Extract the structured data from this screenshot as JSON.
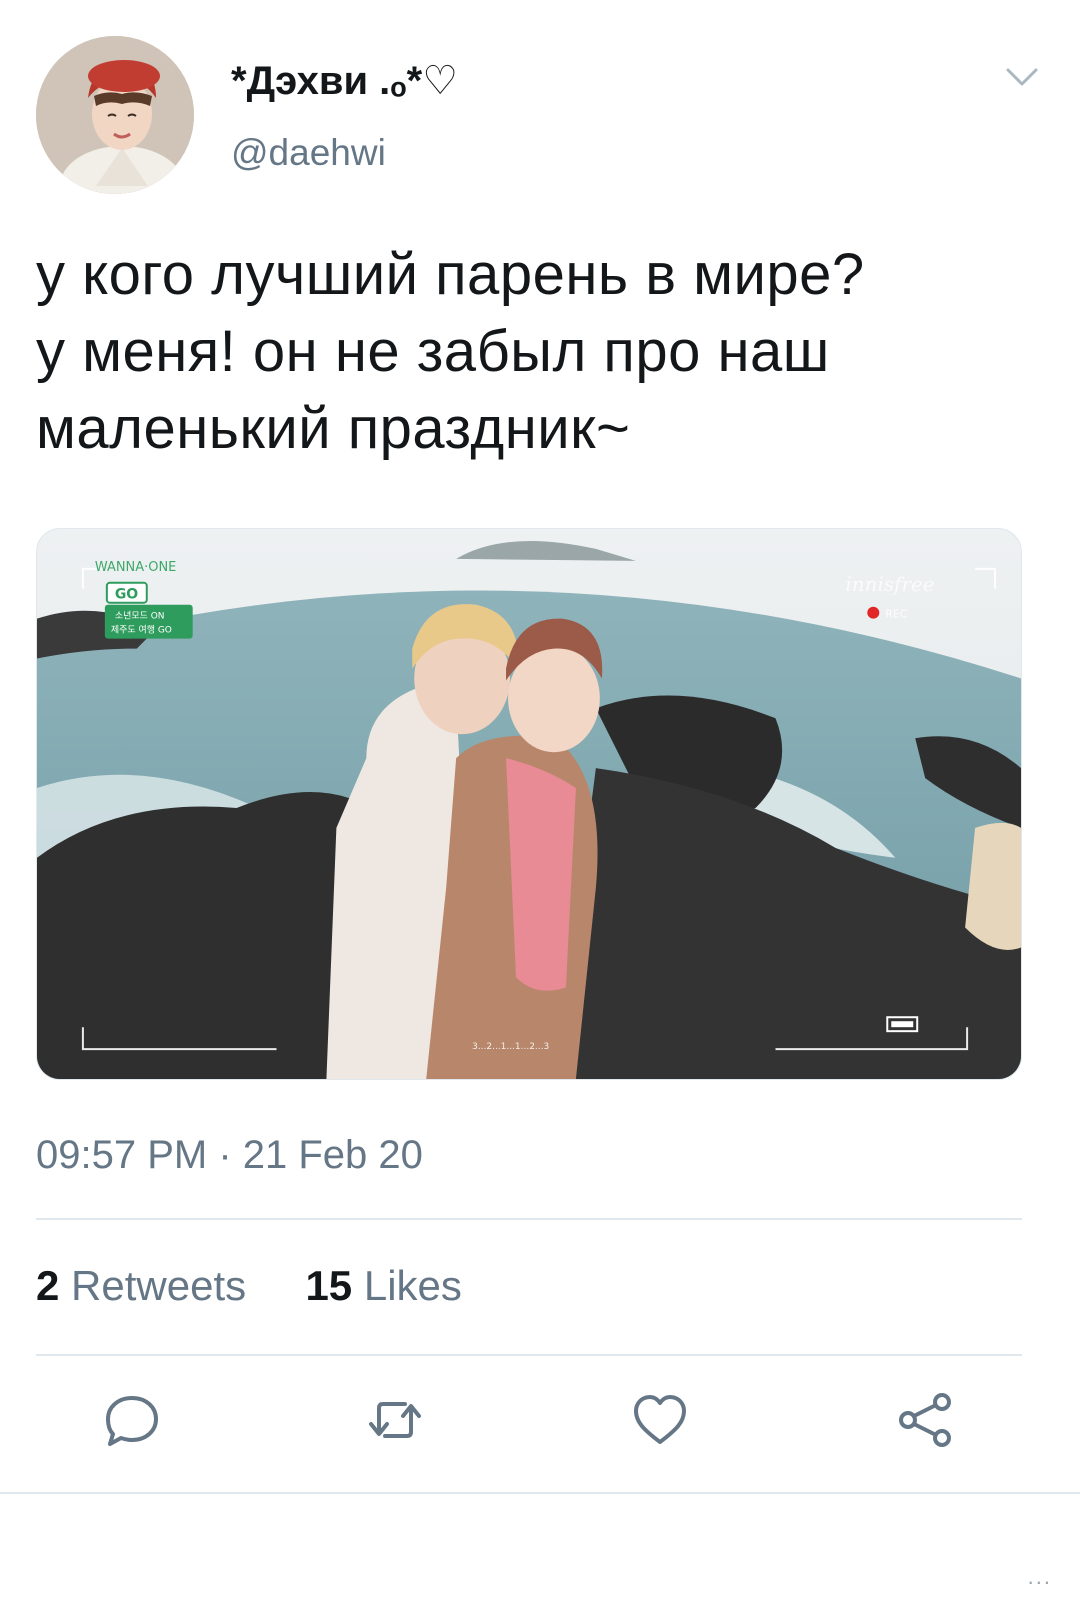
{
  "user": {
    "display_name": "*Дэхви .ₒ*♡",
    "handle": "@daehwi"
  },
  "tweet": {
    "lines": [
      "у кого лучший парень в мире?",
      "у меня! он не забыл про наш",
      "маленький праздник~"
    ],
    "timestamp": "09:57 PM · 21 Feb 20"
  },
  "media": {
    "overlay": {
      "show_logo": "WANNA·ONE",
      "show_go": "GO",
      "show_sub1": "소년모드 ON",
      "show_sub2": "제주도 여행 GO",
      "brand": "innisfree",
      "rec": "REC",
      "counter": "3...2...1...1...2...3"
    }
  },
  "stats": {
    "retweets_count": "2",
    "retweets_label": "Retweets",
    "likes_count": "15",
    "likes_label": "Likes"
  },
  "actions": {
    "reply_icon": "reply-icon",
    "retweet_icon": "retweet-icon",
    "like_icon": "heart-icon",
    "share_icon": "share-icon"
  },
  "footer": {
    "more": "..."
  },
  "colors": {
    "text": "#14171a",
    "muted": "#657786",
    "divider": "#e1e8ed",
    "icon": "#657786"
  }
}
